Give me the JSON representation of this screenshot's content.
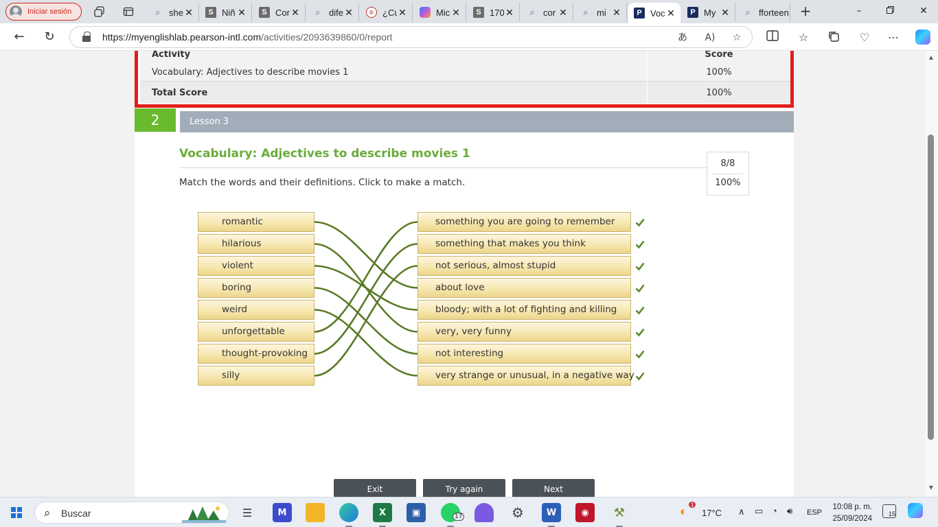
{
  "browser": {
    "signin_label": "Iniciar sesión",
    "tabs": [
      {
        "title": "she",
        "favicon": "search-icon"
      },
      {
        "title": "Niñ",
        "favicon": "s-icon"
      },
      {
        "title": "Cor",
        "favicon": "s-icon"
      },
      {
        "title": "dife",
        "favicon": "search-icon"
      },
      {
        "title": "¿Cu",
        "favicon": "edu-icon"
      },
      {
        "title": "Mic",
        "favicon": "copilot-icon"
      },
      {
        "title": "170",
        "favicon": "s-icon"
      },
      {
        "title": "cor",
        "favicon": "search-icon"
      },
      {
        "title": "mi",
        "favicon": "search-icon"
      },
      {
        "title": "Voc",
        "favicon": "pearson-icon",
        "active": true
      },
      {
        "title": "My",
        "favicon": "pearson-icon"
      },
      {
        "title": "fforteen",
        "favicon": "search-icon"
      }
    ],
    "url_domain": "https://myenglishlab.pearson-intl.com",
    "url_path": "/activities/2093639860/0/report"
  },
  "score_table": {
    "col_activity": "Activity",
    "col_score": "Score",
    "row_activity": "Vocabulary: Adjectives to describe movies 1",
    "row_score": "100%",
    "total_label": "Total Score",
    "total_score": "100%"
  },
  "lesson": {
    "number": "2",
    "name": "Lesson 3"
  },
  "activity": {
    "title": "Vocabulary: Adjectives to describe movies 1",
    "score_fraction": "8/8",
    "score_percent": "100%",
    "instructions": "Match the words and their definitions. Click to make a match.",
    "words": [
      "romantic",
      "hilarious",
      "violent",
      "boring",
      "weird",
      "unforgettable",
      "thought-provoking",
      "silly"
    ],
    "definitions": [
      "something you are going to remember",
      "something that makes you think",
      "not serious, almost stupid",
      "about love",
      "bloody; with a lot of fighting and killing",
      "very, very funny",
      "not interesting",
      "very strange or unusual, in a negative way"
    ],
    "matches": [
      3,
      5,
      4,
      6,
      7,
      0,
      1,
      2
    ],
    "all_correct": true,
    "colors": {
      "line": "#5a7a26",
      "check": "#5a8a2a",
      "title": "#6aab3a",
      "lesson_badge": "#6aba2e",
      "score_border": "#e0201b"
    }
  },
  "buttons": {
    "exit": "Exit",
    "try_again": "Try again",
    "next": "Next"
  },
  "taskbar": {
    "search_placeholder": "Buscar",
    "whatsapp_badge": "17",
    "weather_badge": "1",
    "temperature": "17°C",
    "language": "ESP",
    "time": "10:08 p. m.",
    "date": "25/09/2024",
    "notifications": "15"
  }
}
